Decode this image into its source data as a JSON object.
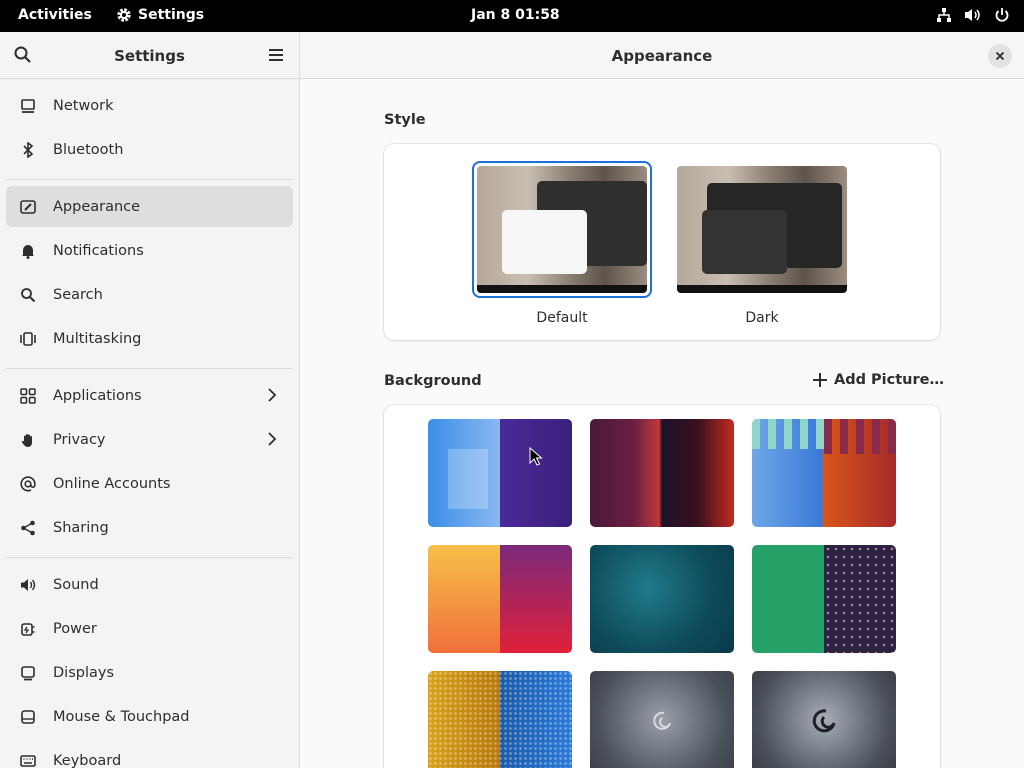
{
  "topbar": {
    "activities": "Activities",
    "app_name": "Settings",
    "clock": "Jan 8  01:58",
    "tray_icons": [
      "network-icon",
      "volume-icon",
      "power-icon"
    ]
  },
  "sidebar": {
    "title": "Settings",
    "items": [
      {
        "label": "Network",
        "icon": "network-icon"
      },
      {
        "label": "Bluetooth",
        "icon": "bluetooth-icon"
      },
      {
        "label": "Appearance",
        "icon": "appearance-icon",
        "active": true
      },
      {
        "label": "Notifications",
        "icon": "bell-icon"
      },
      {
        "label": "Search",
        "icon": "search-icon"
      },
      {
        "label": "Multitasking",
        "icon": "multitasking-icon"
      },
      {
        "label": "Applications",
        "icon": "apps-grid-icon",
        "submenu": true
      },
      {
        "label": "Privacy",
        "icon": "hand-icon",
        "submenu": true
      },
      {
        "label": "Online Accounts",
        "icon": "at-icon"
      },
      {
        "label": "Sharing",
        "icon": "share-icon"
      },
      {
        "label": "Sound",
        "icon": "speaker-icon"
      },
      {
        "label": "Power",
        "icon": "power-plug-icon"
      },
      {
        "label": "Displays",
        "icon": "display-icon"
      },
      {
        "label": "Mouse & Touchpad",
        "icon": "mouse-icon"
      },
      {
        "label": "Keyboard",
        "icon": "keyboard-icon"
      }
    ]
  },
  "main": {
    "title": "Appearance",
    "style": {
      "label": "Style",
      "options": [
        {
          "label": "Default",
          "selected": true
        },
        {
          "label": "Dark",
          "selected": false
        }
      ]
    },
    "background": {
      "label": "Background",
      "add_picture": "Add Picture…",
      "wallpapers": [
        "blue-purple-hexagons",
        "dark-red-waves",
        "blue-orange-drips",
        "orange-red-gradient",
        "teal-space",
        "green-purple-dots",
        "gold-blue-mosaic",
        "debian-swirl-gray",
        "debian-dark-swirl"
      ]
    }
  },
  "colors": {
    "accent": "#3584e4",
    "selection_border": "#1c71d8",
    "topbar_bg": "#000000",
    "sidebar_bg": "#f4f4f4",
    "active_item_bg": "#dedede"
  }
}
